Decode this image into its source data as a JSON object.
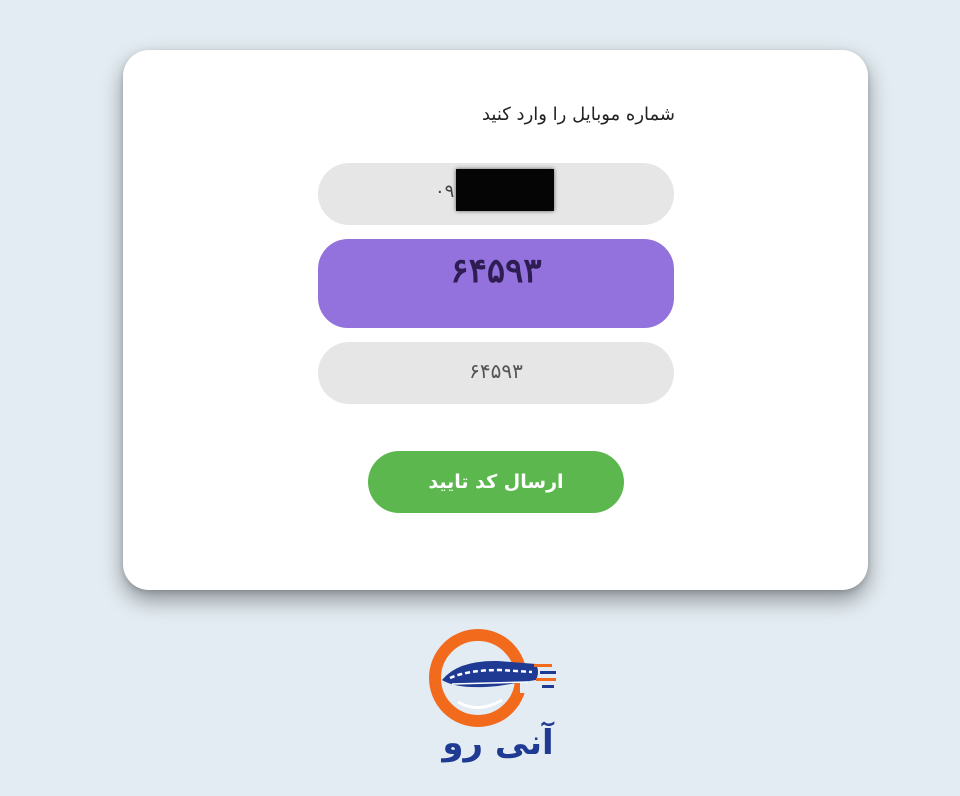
{
  "form": {
    "title": "شماره موبایل را وارد کنید",
    "phone_value": "۰۹",
    "captcha_code": "۶۴۵۹۳",
    "code_value": "۶۴۵۹۳",
    "submit_label": "ارسال کد تایید"
  },
  "brand": {
    "name": "آنی رو",
    "orange": "#f26a1b",
    "blue": "#1f3a93"
  }
}
